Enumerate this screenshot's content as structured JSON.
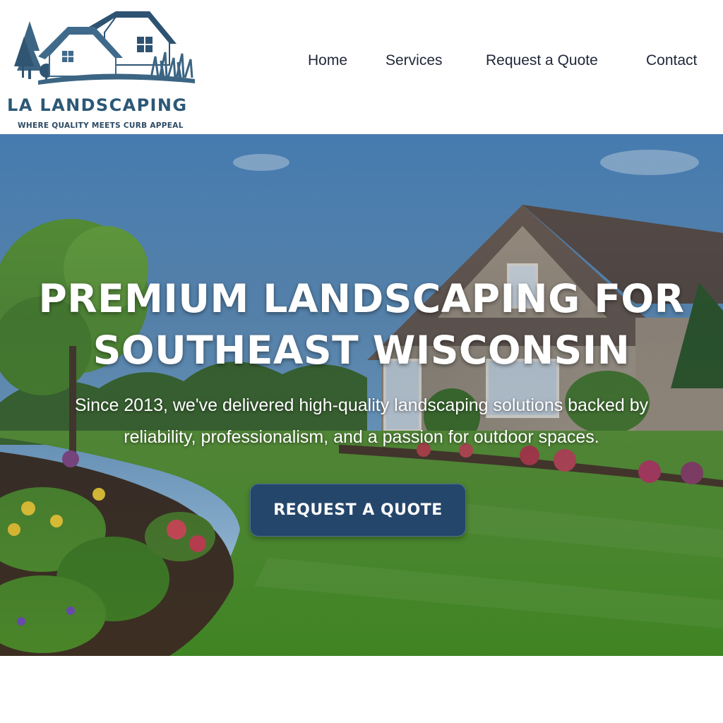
{
  "brand": {
    "name": "LA LANDSCAPING",
    "tagline": "WHERE QUALITY MEETS CURB APPEAL",
    "logo_icon": "house-with-trees-logo-icon",
    "primary_color": "#2c5877"
  },
  "nav": {
    "items": [
      {
        "label": "Home"
      },
      {
        "label": "Services"
      },
      {
        "label": "Request a Quote"
      },
      {
        "label": "Contact"
      }
    ]
  },
  "hero": {
    "title_line1": "PREMIUM LANDSCAPING FOR",
    "title_line2": "SOUTHEAST WISCONSIN",
    "subtitle_line1": "Since 2013, we've delivered high-quality landscaping solutions backed by",
    "subtitle_line2": "reliability, professionalism, and a passion for outdoor spaces.",
    "cta_label": "REQUEST A QUOTE",
    "cta_color": "#25466b",
    "background": "photo-of-house-with-lawn-and-flower-beds"
  }
}
